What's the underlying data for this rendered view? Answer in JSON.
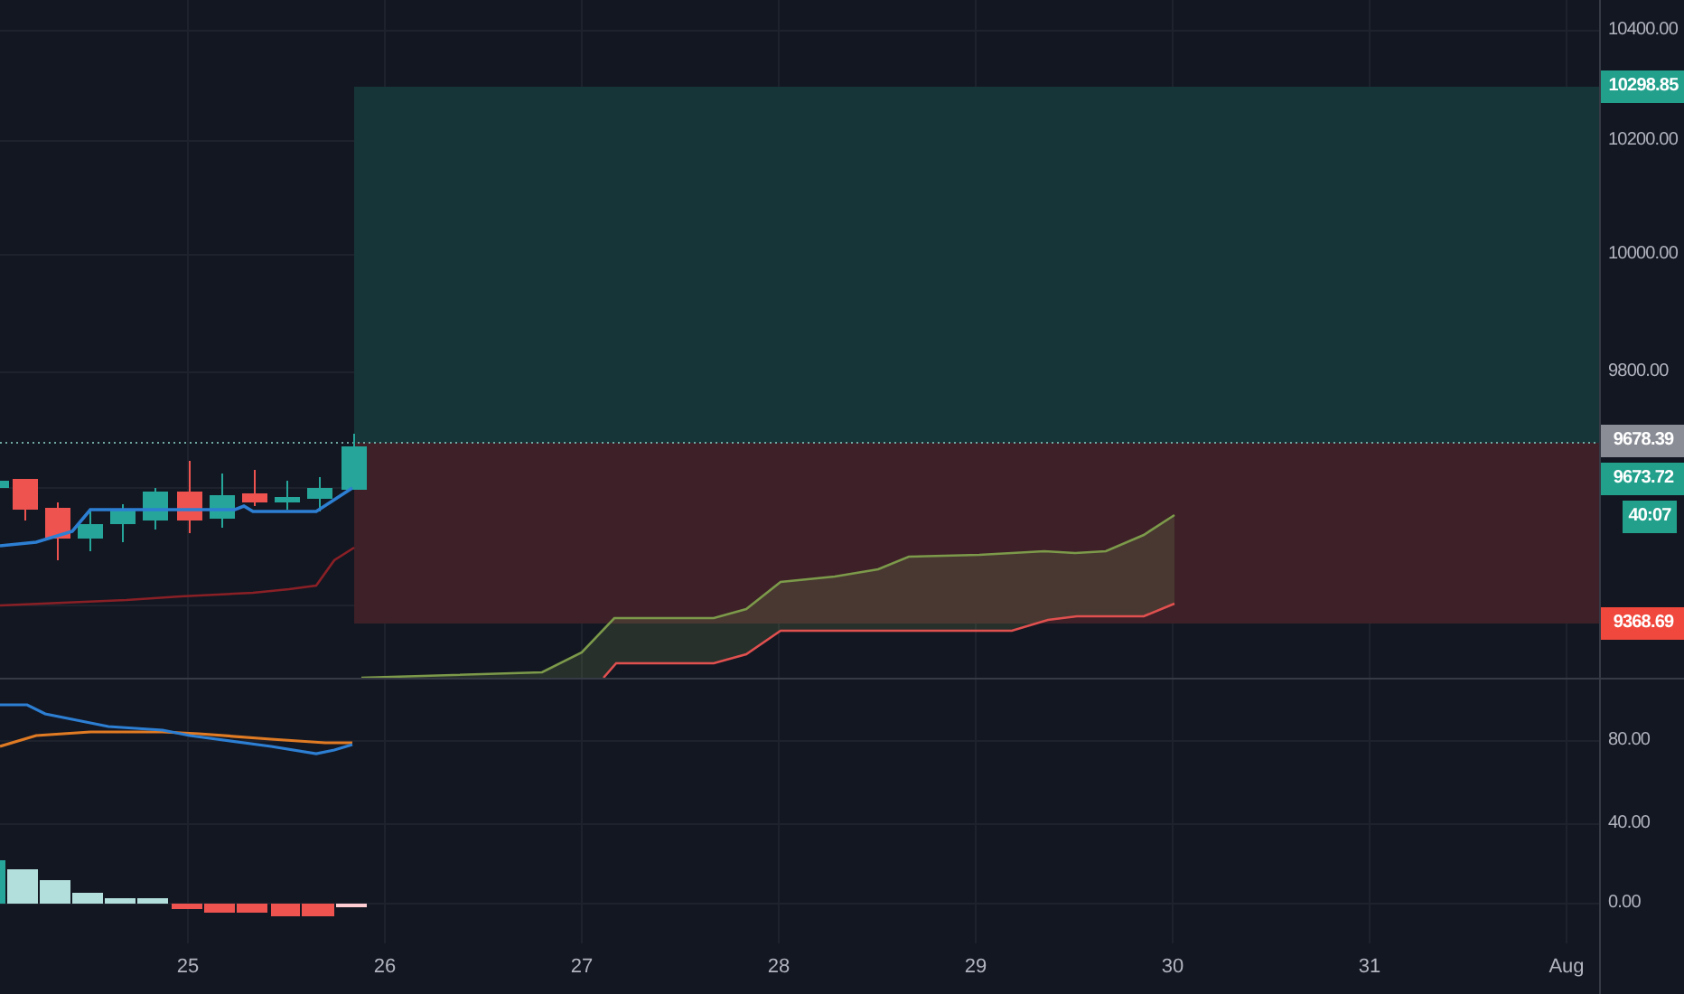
{
  "price_axis": {
    "ticks": [
      "10400.00",
      "10200.00",
      "10000.00",
      "9800.00"
    ],
    "tags": [
      {
        "text": "10298.85",
        "kind": "target"
      },
      {
        "text": "9678.39",
        "kind": "entry"
      },
      {
        "text": "9673.72",
        "kind": "last"
      },
      {
        "text": "40:07",
        "kind": "countdown"
      },
      {
        "text": "9368.69",
        "kind": "stop"
      }
    ]
  },
  "indicator_axis": {
    "ticks": [
      "80.00",
      "40.00",
      "0.00"
    ]
  },
  "time_axis": {
    "ticks": [
      "25",
      "26",
      "27",
      "28",
      "29",
      "30",
      "31",
      "Aug"
    ]
  }
}
